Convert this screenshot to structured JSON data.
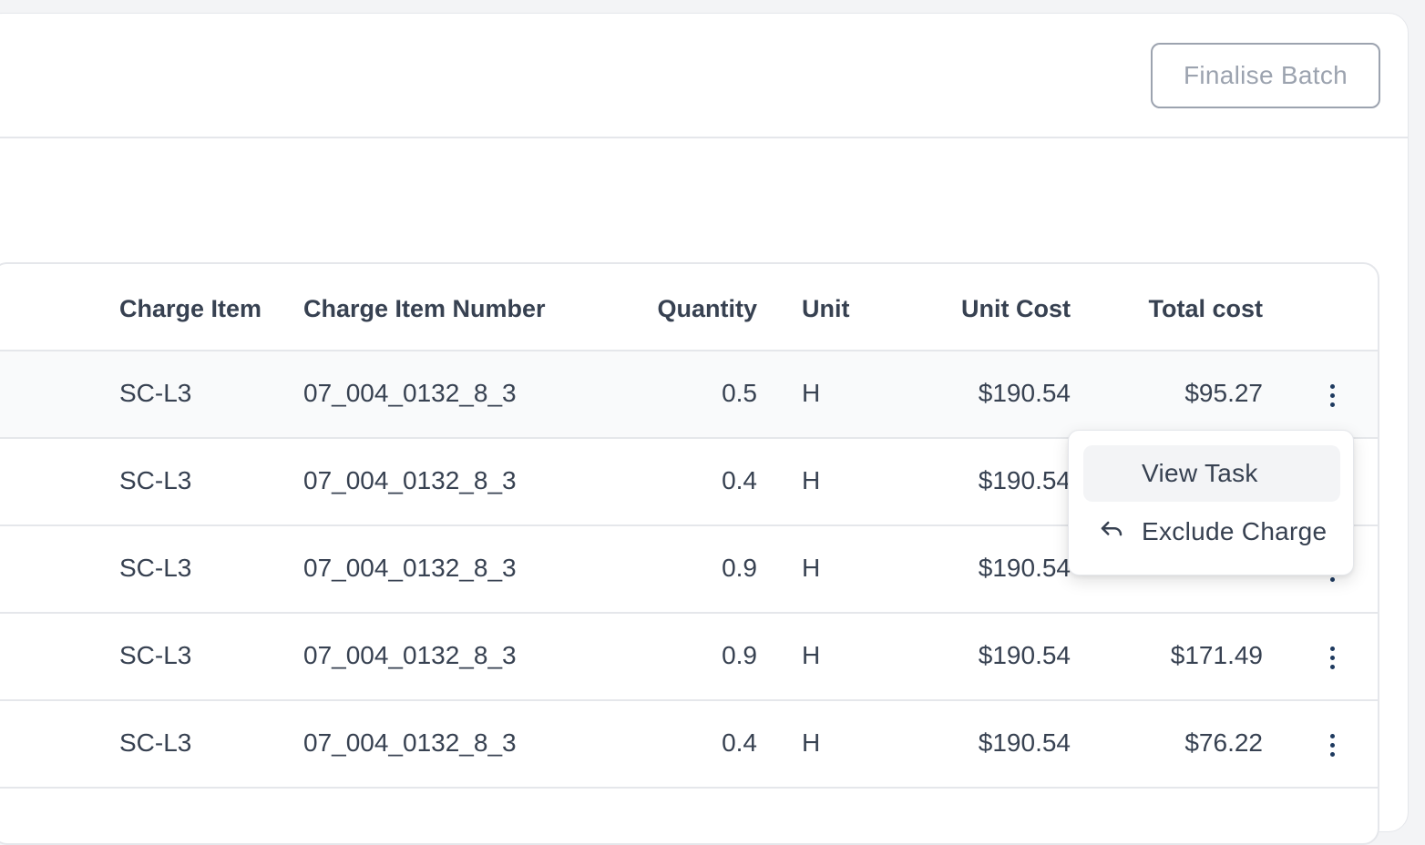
{
  "header": {
    "finalise_label": "Finalise Batch"
  },
  "table": {
    "columns": {
      "charge_item": "Charge Item",
      "charge_item_number": "Charge Item Number",
      "quantity": "Quantity",
      "unit": "Unit",
      "unit_cost": "Unit Cost",
      "total_cost": "Total cost"
    },
    "rows": [
      {
        "charge_item": "SC-L3",
        "charge_item_number": "07_004_0132_8_3",
        "quantity": "0.5",
        "unit": "H",
        "unit_cost": "$190.54",
        "total_cost": "$95.27"
      },
      {
        "charge_item": "SC-L3",
        "charge_item_number": "07_004_0132_8_3",
        "quantity": "0.4",
        "unit": "H",
        "unit_cost": "$190.54",
        "total_cost": ""
      },
      {
        "charge_item": "SC-L3",
        "charge_item_number": "07_004_0132_8_3",
        "quantity": "0.9",
        "unit": "H",
        "unit_cost": "$190.54",
        "total_cost": ""
      },
      {
        "charge_item": "SC-L3",
        "charge_item_number": "07_004_0132_8_3",
        "quantity": "0.9",
        "unit": "H",
        "unit_cost": "$190.54",
        "total_cost": "$171.49"
      },
      {
        "charge_item": "SC-L3",
        "charge_item_number": "07_004_0132_8_3",
        "quantity": "0.4",
        "unit": "H",
        "unit_cost": "$190.54",
        "total_cost": "$76.22"
      }
    ]
  },
  "row_menu": {
    "items": [
      {
        "label": "View Task",
        "icon": "none"
      },
      {
        "label": "Exclude Charge",
        "icon": "undo-icon"
      }
    ]
  },
  "colors": {
    "accent": "#1e3a5f",
    "border": "#e5e7eb",
    "text": "#374151",
    "muted": "#9ca3af"
  }
}
